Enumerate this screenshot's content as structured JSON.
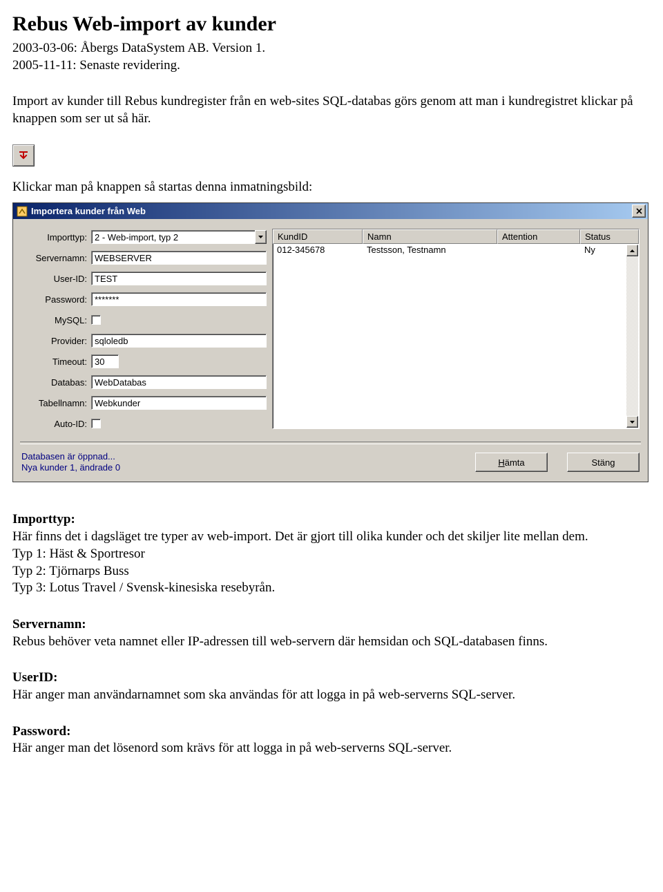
{
  "doc": {
    "title": "Rebus Web-import av kunder",
    "line1": "2003-03-06: Åbergs DataSystem AB. Version 1.",
    "line2": "2005-11-11: Senaste revidering.",
    "intro": "Import av kunder till Rebus kundregister från en web-sites SQL-databas görs genom att man i kundregistret klickar på knappen som ser ut så här.",
    "after_icon": "Klickar man på knappen så startas denna inmatningsbild:"
  },
  "dialog": {
    "title": "Importera kunder från Web",
    "labels": {
      "importtyp": "Importtyp:",
      "servernamn": "Servernamn:",
      "userid": "User-ID:",
      "password": "Password:",
      "mysql": "MySQL:",
      "provider": "Provider:",
      "timeout": "Timeout:",
      "databas": "Databas:",
      "tabellnamn": "Tabellnamn:",
      "autoid": "Auto-ID:"
    },
    "values": {
      "importtyp": "2  - Web-import, typ 2",
      "servernamn": "WEBSERVER",
      "userid": "TEST",
      "password": "*******",
      "provider": "sqloledb",
      "timeout": "30",
      "databas": "WebDatabas",
      "tabellnamn": "Webkunder"
    },
    "list": {
      "headers": {
        "kundid": "KundID",
        "namn": "Namn",
        "attention": "Attention",
        "status": "Status"
      },
      "rows": [
        {
          "kundid": "012-345678",
          "namn": "Testsson, Testnamn",
          "attention": "",
          "status": "Ny"
        }
      ]
    },
    "status": {
      "line1": "Databasen är öppnad...",
      "line2": "Nya kunder 1, ändrade 0"
    },
    "buttons": {
      "fetch_prefix": "H",
      "fetch_rest": "ämta",
      "close": "Stäng"
    }
  },
  "sections": {
    "importtyp": {
      "title": "Importtyp:",
      "p1": "Här finns det i dagsläget tre typer av web-import. Det är gjort till olika kunder och det skiljer lite mellan dem.",
      "t1": "Typ 1: Häst & Sportresor",
      "t2": "Typ 2: Tjörnarps Buss",
      "t3": "Typ 3: Lotus Travel / Svensk-kinesiska resebyrån."
    },
    "servernamn": {
      "title": "Servernamn:",
      "p": "Rebus behöver veta namnet eller IP-adressen till web-servern där hemsidan och SQL-databasen finns."
    },
    "userid": {
      "title": "UserID:",
      "p": "Här anger man användarnamnet som ska användas för att logga in på web-serverns SQL-server."
    },
    "password": {
      "title": "Password:",
      "p": "Här anger man det lösenord som krävs för att logga in på web-serverns SQL-server."
    }
  }
}
